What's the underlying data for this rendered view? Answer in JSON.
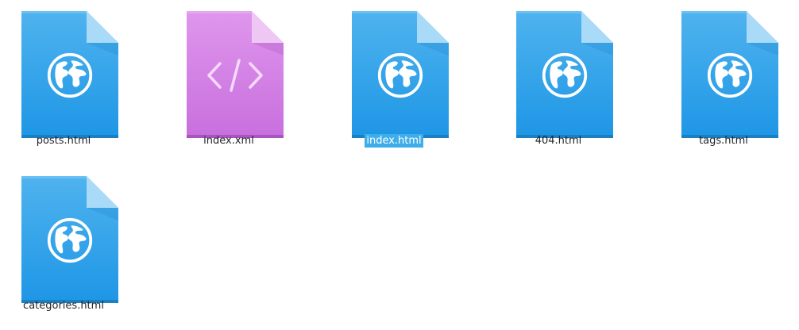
{
  "files": [
    {
      "name": "posts.html",
      "type": "html",
      "icon": "globe-icon",
      "selected": false
    },
    {
      "name": "index.xml",
      "type": "xml",
      "icon": "code-icon",
      "selected": false
    },
    {
      "name": "index.html",
      "type": "html",
      "icon": "globe-icon",
      "selected": true
    },
    {
      "name": "404.html",
      "type": "html",
      "icon": "globe-icon",
      "selected": false
    },
    {
      "name": "tags.html",
      "type": "html",
      "icon": "globe-icon",
      "selected": false
    },
    {
      "name": "categories.html",
      "type": "html",
      "icon": "globe-icon",
      "selected": false
    }
  ],
  "colors": {
    "html_top": "#4fb3ee",
    "html_bottom": "#1e96e6",
    "html_fold": "#a7d8f6",
    "html_edge": "#1b82c9",
    "xml_top": "#db8ee9",
    "xml_bottom": "#c96fdf",
    "xml_fold": "#ecc2f3",
    "xml_edge": "#b25ac8",
    "selection": "#3daee9"
  }
}
